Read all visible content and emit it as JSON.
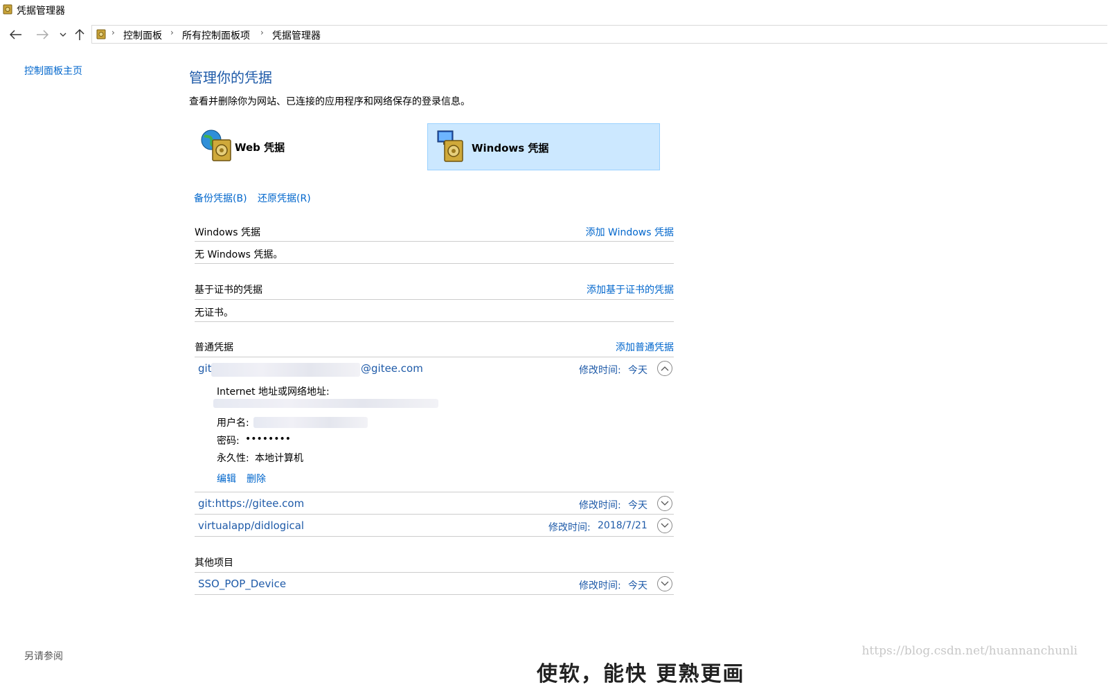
{
  "window": {
    "title": "凭据管理器"
  },
  "breadcrumb": [
    "控制面板",
    "所有控制面板项",
    "凭据管理器"
  ],
  "left_nav": {
    "home": "控制面板主页",
    "see_also": "另请参阅"
  },
  "main": {
    "title": "管理你的凭据",
    "description": "查看并删除你为网站、已连接的应用程序和网络保存的登录信息。",
    "tiles": {
      "web": "Web 凭据",
      "windows": "Windows 凭据",
      "selected": "windows"
    },
    "backup": "备份凭据(B)",
    "restore": "还原凭据(R)"
  },
  "sections": {
    "windows": {
      "title": "Windows 凭据",
      "add": "添加 Windows 凭据",
      "empty": "无 Windows 凭据。"
    },
    "cert": {
      "title": "基于证书的凭据",
      "add": "添加基于证书的凭据",
      "empty": "无证书。"
    },
    "generic": {
      "title": "普通凭据",
      "add": "添加普通凭据",
      "expanded": {
        "name_prefix": "git",
        "name_suffix": "@gitee.com",
        "mod_label": "修改时间:",
        "mod_value": "今天",
        "address_label": "Internet 地址或网络地址:",
        "user_label": "用户名:",
        "password_label": "密码:",
        "password_value": "••••••••",
        "persistence_label": "永久性:",
        "persistence_value": "本地计算机",
        "edit": "编辑",
        "delete": "删除"
      },
      "items": [
        {
          "name": "git:https://gitee.com",
          "mod_label": "修改时间:",
          "mod_value": "今天"
        },
        {
          "name": "virtualapp/didlogical",
          "mod_label": "修改时间:",
          "mod_value": "2018/7/21"
        }
      ]
    },
    "other": {
      "title": "其他项目",
      "items": [
        {
          "name": "SSO_POP_Device",
          "mod_label": "修改时间:",
          "mod_value": "今天"
        }
      ]
    }
  },
  "watermark": "https://blog.csdn.net/huannanchunli",
  "overlay_text": "使软，能快 更熟更画"
}
